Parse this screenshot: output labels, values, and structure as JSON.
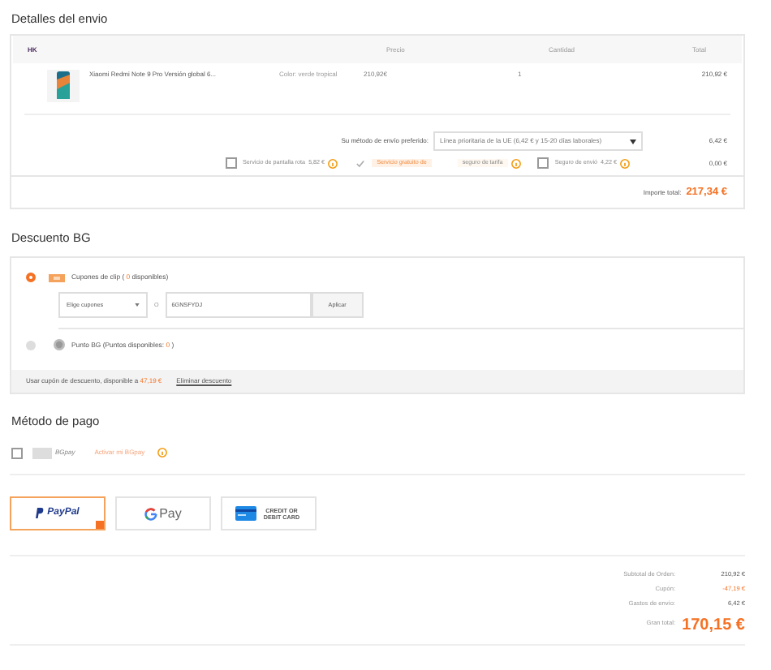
{
  "shipping": {
    "title": "Detalles del envio",
    "columns": [
      "HK",
      "Precio",
      "Cantidad",
      "Total"
    ],
    "items": [
      {
        "name": "Xiaomi Redmi Note 9 Pro Versión global 6...",
        "variant": "Color: verde tropical",
        "price": "210,92€",
        "quantity": "1",
        "total": "210,92 €"
      }
    ],
    "method_label": "Su método de envío preferido:",
    "method_value": "Línea prioritaria de la UE (6,42 € y 15-20 días laborales)",
    "method_price": "6,42 €",
    "options": [
      {
        "label": "Servicio de pantalla rota",
        "price": "5,82 €",
        "checked": false,
        "highlighted": false
      },
      {
        "label": "Servicio gratuito de",
        "price": "seguro de tarifa",
        "checked": true,
        "highlighted": true
      },
      {
        "label": "Seguro de envió",
        "price": "4,22 €",
        "checked": false,
        "highlighted": false
      }
    ],
    "options_total": "0,00 €",
    "total_label": "Importe total:",
    "total": "217,34 €"
  },
  "discount": {
    "title": "Descuento BG",
    "methods": [
      {
        "kind": "coupon",
        "label": "Cupones de clip (",
        "count": "0",
        "suffix": "disponibles)",
        "selected": true
      },
      {
        "kind": "points",
        "label": "Punto BG (Puntos disponibles:",
        "count": "0",
        "suffix": ")",
        "selected": false
      }
    ],
    "coupon_select": "Elige cupones",
    "or": "O",
    "coupon_code": "6GNSFYDJ",
    "apply": "Aplicar",
    "footer_text": "Usar cupón de descuento, disponible a",
    "footer_amount": "47,19 €",
    "remove": "Eliminar descuento"
  },
  "payment": {
    "title": "Método de pago",
    "bgpay": {
      "label": "BGpay",
      "checked": false,
      "activate": "Activar mi BGpay"
    },
    "methods": [
      {
        "kind": "paypal",
        "label": "PayPal",
        "selected": true
      },
      {
        "kind": "gpay",
        "label": "Pay",
        "selected": false
      },
      {
        "kind": "card",
        "label": "CREDIT OR DEBIT CARD",
        "selected": false
      }
    ]
  },
  "summary": {
    "rows": [
      {
        "label": "Subtotal de Orden:",
        "value": "210,92 €",
        "kind": "normal"
      },
      {
        "label": "Cupón:",
        "value": "-47,19 €",
        "kind": "discount"
      },
      {
        "label": "Gastos de envío:",
        "value": "6,42 €",
        "kind": "normal"
      }
    ],
    "total_label": "Gran total:",
    "total": "170,15 €"
  }
}
